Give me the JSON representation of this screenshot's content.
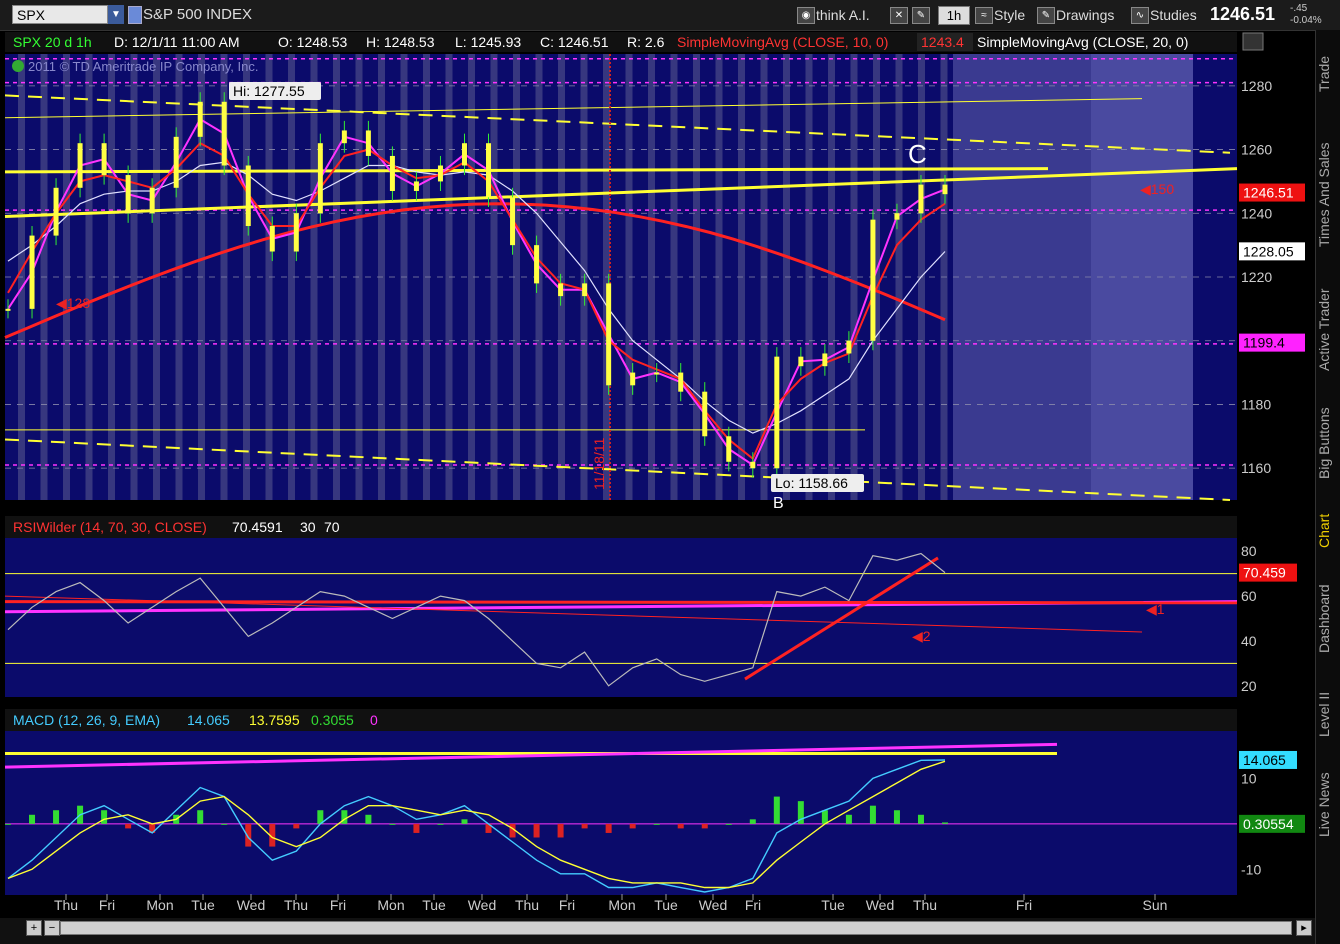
{
  "toolbar": {
    "symbol": "SPX",
    "index_name": "S&P 500 INDEX",
    "think_label": "think A.I.",
    "timeframe": "1h",
    "style_label": "Style",
    "drawings_label": "Drawings",
    "studies_label": "Studies",
    "last_price": "1246.51",
    "change_points": "-.45",
    "change_pct": "-0.04%"
  },
  "colors": {
    "background": "#0b0b6b",
    "weekend_band": "#3a3a90",
    "grid_bar": "#5c5c90",
    "yellow": "#ffff33",
    "magenta": "#ff33ff",
    "red": "#ff2222",
    "sma20": "#e0e0ff",
    "cyan": "#44ccff",
    "green_hist": "#33dd33",
    "red_hist": "#dd2222"
  },
  "sidebar": {
    "tabs": [
      "Trade",
      "Times And Sales",
      "Active Trader",
      "Big Buttons",
      "Chart",
      "Dashboard",
      "Level II",
      "Live News"
    ],
    "active": "Chart"
  },
  "price_panel": {
    "header": {
      "title": "SPX 20 d 1h",
      "date": "D: 12/1/11 11:00 AM",
      "open": "O: 1248.53",
      "high": "H: 1248.53",
      "low": "L: 1245.93",
      "close": "C: 1246.51",
      "range": "R: 2.6",
      "sma10_label": "SimpleMovingAvg (CLOSE, 10, 0)",
      "sma10_value": "1243.4",
      "sma20_label": "SimpleMovingAvg (CLOSE, 20, 0)"
    },
    "copyright": "2011 © TD Ameritrade IP Company, Inc.",
    "hi_label": "Hi: 1277.55",
    "lo_label": "Lo: 1158.66",
    "annotations": [
      {
        "text": "128"
      },
      {
        "text": "C"
      },
      {
        "text": "150"
      },
      {
        "text": "11/18/11"
      },
      {
        "text": "B"
      }
    ],
    "price_badges": [
      {
        "text": "1246.51",
        "bg": "#ee1111",
        "fg": "#ffffff"
      },
      {
        "text": "1228.05",
        "bg": "#ffffff",
        "fg": "#000000"
      },
      {
        "text": "1199.4",
        "bg": "#ff22ff",
        "fg": "#000000"
      }
    ]
  },
  "rsi_panel": {
    "header": {
      "label": "RSIWilder (14, 70, 30, CLOSE)",
      "value": "70.4591",
      "lower": "30",
      "upper": "70"
    },
    "badge": "70.459",
    "annotations": [
      {
        "text": "1"
      },
      {
        "text": "2"
      }
    ]
  },
  "macd_panel": {
    "header": {
      "label": "MACD (12, 26, 9, EMA)",
      "value": "14.065",
      "avg": "13.7595",
      "diff": "0.3055",
      "zero": "0"
    },
    "badges": [
      {
        "text": "14.065",
        "bg": "#33ddff"
      },
      {
        "text": "0.30554",
        "bg": "#118811"
      }
    ]
  },
  "x_axis": {
    "labels": [
      "Thu",
      "Fri",
      "Mon",
      "Tue",
      "Wed",
      "Thu",
      "Fri",
      "Mon",
      "Tue",
      "Wed",
      "Thu",
      "Fri",
      "Mon",
      "Tue",
      "Wed",
      "Fri",
      "Tue",
      "Wed",
      "Thu",
      "Fri",
      "Sun"
    ]
  },
  "chart_data": [
    {
      "type": "line",
      "panel": "price",
      "title": "SPX 20 d 1h",
      "ylim": [
        1150,
        1290
      ],
      "yticks": [
        1160,
        1180,
        1200,
        1220,
        1240,
        1260,
        1280
      ],
      "series": [
        {
          "name": "SPX",
          "values": [
            1210,
            1233,
            1248,
            1262,
            1252,
            1240,
            1248,
            1264,
            1275,
            1255,
            1236,
            1228,
            1240,
            1262,
            1266,
            1258,
            1247,
            1250,
            1255,
            1262,
            1245,
            1230,
            1218,
            1214,
            1218,
            1186,
            1190,
            1190,
            1184,
            1170,
            1162,
            1160,
            1195,
            1192,
            1196,
            1200,
            1238,
            1240,
            1249,
            1246
          ]
        },
        {
          "name": "SimpleMovingAvg (CLOSE, 10, 0)",
          "values": [
            1215,
            1228,
            1240,
            1250,
            1252,
            1250,
            1248,
            1254,
            1262,
            1258,
            1246,
            1236,
            1236,
            1248,
            1258,
            1260,
            1255,
            1251,
            1252,
            1256,
            1250,
            1238,
            1226,
            1218,
            1216,
            1200,
            1194,
            1191,
            1188,
            1178,
            1169,
            1163,
            1180,
            1188,
            1193,
            1196,
            1214,
            1230,
            1238,
            1243
          ]
        },
        {
          "name": "SimpleMovingAvg (CLOSE, 20, 0)",
          "values": [
            1225,
            1230,
            1236,
            1243,
            1246,
            1247,
            1247,
            1250,
            1255,
            1256,
            1252,
            1246,
            1244,
            1247,
            1251,
            1255,
            1255,
            1253,
            1252,
            1253,
            1252,
            1247,
            1240,
            1231,
            1222,
            1210,
            1200,
            1194,
            1188,
            1181,
            1175,
            1171,
            1174,
            1178,
            1183,
            1188,
            1200,
            1210,
            1220,
            1228
          ]
        }
      ],
      "lows": [
        "Lo: 1158.66"
      ],
      "highs": [
        "Hi: 1277.55"
      ]
    },
    {
      "type": "line",
      "panel": "rsi",
      "title": "RSIWilder (14, 70, 30, CLOSE)",
      "ylim": [
        15,
        85
      ],
      "yticks": [
        20,
        40,
        60,
        80
      ],
      "levels": [
        30,
        70
      ],
      "series": [
        {
          "name": "RSIWilder (14, 70, 30, CLOSE)",
          "values": [
            45,
            55,
            62,
            66,
            58,
            48,
            55,
            62,
            68,
            55,
            42,
            48,
            55,
            62,
            60,
            55,
            50,
            55,
            60,
            58,
            50,
            40,
            30,
            28,
            35,
            20,
            28,
            32,
            25,
            22,
            25,
            28,
            62,
            60,
            64,
            58,
            78,
            76,
            79,
            70.46
          ]
        }
      ]
    },
    {
      "type": "bar",
      "panel": "macd",
      "title": "MACD (12, 26, 9, EMA)",
      "ylim": [
        -15,
        20
      ],
      "yticks": [
        -10,
        10
      ],
      "series": [
        {
          "name": "MACD",
          "values": [
            -12,
            -8,
            -3,
            2,
            4,
            1,
            -2,
            3,
            8,
            6,
            -3,
            -8,
            -6,
            0,
            4,
            6,
            4,
            1,
            2,
            4,
            0,
            -4,
            -8,
            -11,
            -11,
            -14,
            -14,
            -13,
            -14,
            -15,
            -14,
            -12,
            -2,
            1,
            3,
            5,
            10,
            12,
            14,
            14.065
          ]
        },
        {
          "name": "Avg",
          "values": [
            -12,
            -10,
            -6,
            -2,
            1,
            2,
            0,
            1,
            5,
            6,
            2,
            -3,
            -5,
            -3,
            1,
            4,
            4,
            3,
            2,
            3,
            2,
            -1,
            -5,
            -8,
            -10,
            -12,
            -13,
            -13,
            -13,
            -14,
            -14,
            -13,
            -8,
            -4,
            0,
            3,
            6,
            9,
            12,
            13.76
          ]
        },
        {
          "name": "Diff",
          "values": [
            0,
            2,
            3,
            4,
            3,
            -1,
            -2,
            2,
            3,
            0,
            -5,
            -5,
            -1,
            3,
            3,
            2,
            0,
            -2,
            0,
            1,
            -2,
            -3,
            -3,
            -3,
            -1,
            -2,
            -1,
            0,
            -1,
            -1,
            0,
            1,
            6,
            5,
            3,
            2,
            4,
            3,
            2,
            0.31
          ]
        }
      ]
    }
  ]
}
